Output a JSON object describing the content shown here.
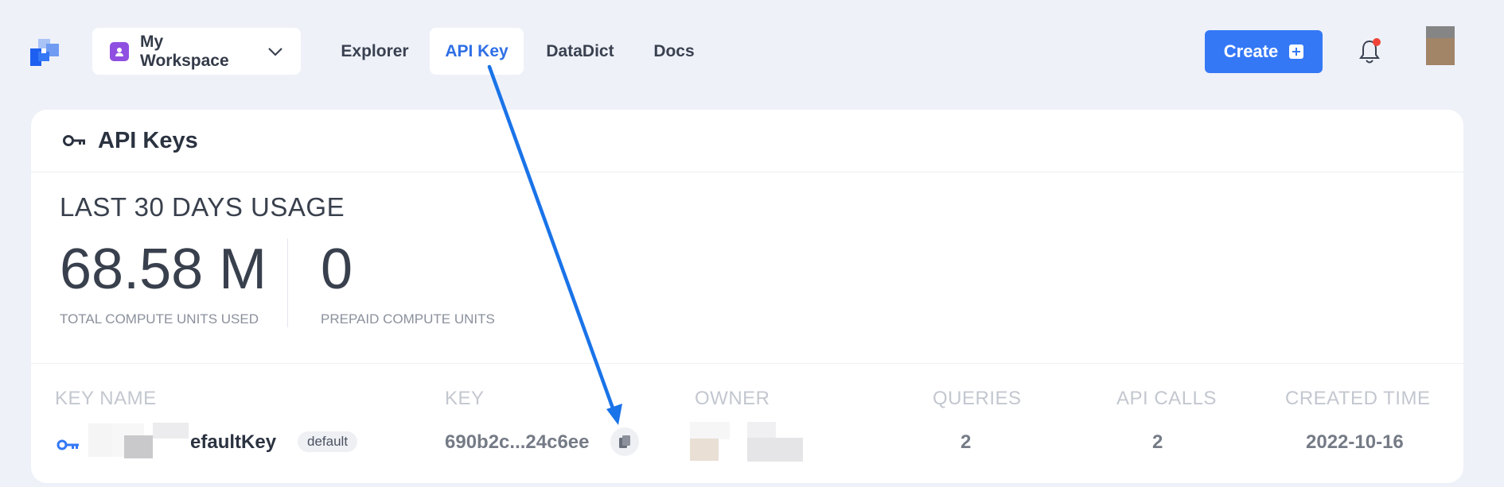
{
  "nav": {
    "workspace": "My Workspace",
    "links": [
      {
        "label": "Explorer",
        "active": false
      },
      {
        "label": "API Key",
        "active": true
      },
      {
        "label": "DataDict",
        "active": false
      },
      {
        "label": "Docs",
        "active": false
      }
    ],
    "create_label": "Create"
  },
  "card": {
    "title": "API Keys",
    "usage_title": "LAST 30 DAYS USAGE",
    "stats": [
      {
        "value": "68.58 M",
        "label": "TOTAL COMPUTE UNITS USED"
      },
      {
        "value": "0",
        "label": "PREPAID COMPUTE UNITS"
      }
    ],
    "table": {
      "headers": [
        "KEY NAME",
        "KEY",
        "OWNER",
        "QUERIES",
        "API CALLS",
        "CREATED TIME"
      ],
      "rows": [
        {
          "name_visible": "efaultKey",
          "badge": "default",
          "key": "690b2c...24c6ee",
          "queries": "2",
          "api_calls": "2",
          "created": "2022-10-16"
        }
      ]
    }
  },
  "colors": {
    "accent": "#3478f6",
    "arrow": "#1a73e8",
    "notify_dot": "#f04438",
    "workspace_icon": "#8f4fe0"
  }
}
